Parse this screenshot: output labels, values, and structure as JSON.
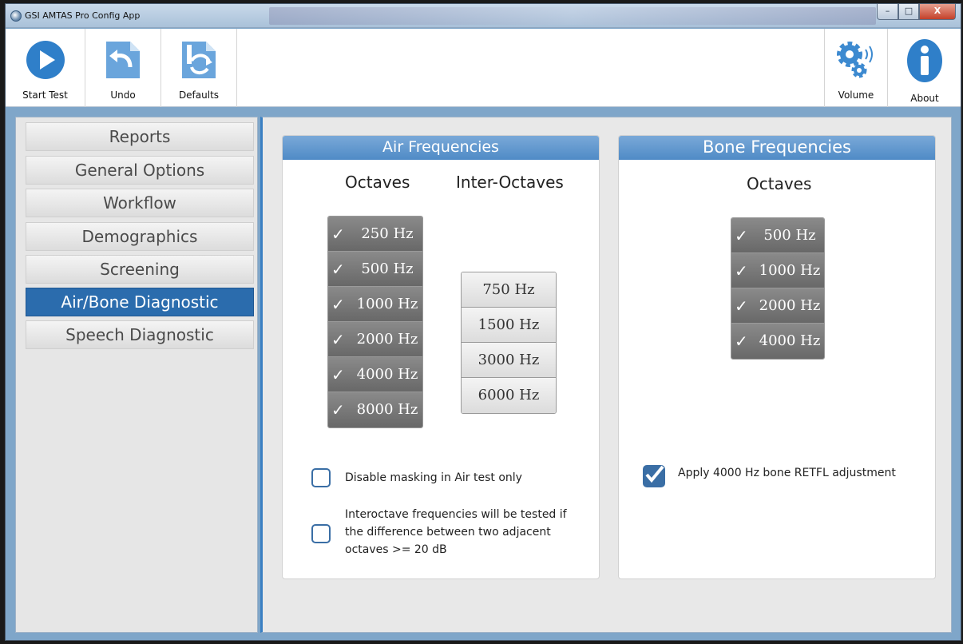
{
  "window": {
    "title": "GSI AMTAS Pro Config App"
  },
  "titlebar_buttons": {
    "minimize": "–",
    "maximize": "□",
    "close": "X"
  },
  "toolbar": {
    "start_test": "Start Test",
    "undo": "Undo",
    "defaults": "Defaults",
    "volume": "Volume",
    "about": "About"
  },
  "nav": {
    "items": [
      {
        "label": "Reports"
      },
      {
        "label": "General Options"
      },
      {
        "label": "Workflow"
      },
      {
        "label": "Demographics"
      },
      {
        "label": "Screening"
      },
      {
        "label": "Air/Bone Diagnostic"
      },
      {
        "label": "Speech Diagnostic"
      }
    ],
    "selected": "Air/Bone Diagnostic"
  },
  "air": {
    "title": "Air Frequencies",
    "octaves_label": "Octaves",
    "interoctaves_label": "Inter-Octaves",
    "octaves": [
      {
        "label": "250 Hz",
        "checked": true
      },
      {
        "label": "500 Hz",
        "checked": true
      },
      {
        "label": "1000 Hz",
        "checked": true
      },
      {
        "label": "2000 Hz",
        "checked": true
      },
      {
        "label": "4000 Hz",
        "checked": true
      },
      {
        "label": "8000 Hz",
        "checked": true
      }
    ],
    "interoctaves": [
      {
        "label": "750 Hz",
        "checked": false
      },
      {
        "label": "1500 Hz",
        "checked": false
      },
      {
        "label": "3000 Hz",
        "checked": false
      },
      {
        "label": "6000 Hz",
        "checked": false
      }
    ],
    "disable_masking": {
      "label": "Disable masking in Air test only",
      "checked": false
    },
    "interoctave_rule": {
      "lines": [
        "Interoctave frequencies will be tested if",
        "the difference between two adjacent",
        "octaves >= 20 dB"
      ],
      "checked": false
    }
  },
  "bone": {
    "title": "Bone Frequencies",
    "octaves_label": "Octaves",
    "octaves": [
      {
        "label": "500 Hz",
        "checked": true
      },
      {
        "label": "1000 Hz",
        "checked": true
      },
      {
        "label": "2000 Hz",
        "checked": true
      },
      {
        "label": "4000 Hz",
        "checked": true
      }
    ],
    "retfl": {
      "label": "Apply 4000 Hz bone RETFL adjustment",
      "checked": true
    }
  },
  "check_glyph": "✓",
  "colors": {
    "accent": "#2b6cad",
    "header": "#5b94cc",
    "checked_btn": "#787878"
  }
}
